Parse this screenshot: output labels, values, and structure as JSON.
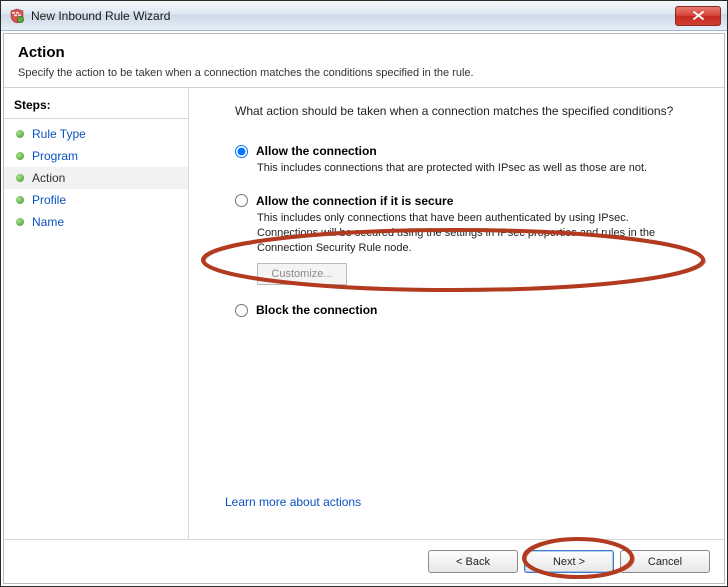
{
  "titlebar": {
    "title": "New Inbound Rule Wizard"
  },
  "header": {
    "title": "Action",
    "subtitle": "Specify the action to be taken when a connection matches the conditions specified in the rule."
  },
  "steps": {
    "title": "Steps:",
    "items": [
      {
        "label": "Rule Type",
        "active": false
      },
      {
        "label": "Program",
        "active": false
      },
      {
        "label": "Action",
        "active": true
      },
      {
        "label": "Profile",
        "active": false
      },
      {
        "label": "Name",
        "active": false
      }
    ]
  },
  "main": {
    "question": "What action should be taken when a connection matches the specified conditions?",
    "options": {
      "allow": {
        "label": "Allow the connection",
        "desc": "This includes connections that are protected with IPsec as well as those are not."
      },
      "secure": {
        "label": "Allow the connection if it is secure",
        "desc": "This includes only connections that have been authenticated by using IPsec.  Connections will be secured using the settings in IPsec properties and rules in the Connection Security Rule node.",
        "customize_label": "Customize..."
      },
      "block": {
        "label": "Block the connection"
      }
    },
    "learn_link": "Learn more about actions"
  },
  "buttons": {
    "back": "< Back",
    "next": "Next >",
    "cancel": "Cancel"
  }
}
